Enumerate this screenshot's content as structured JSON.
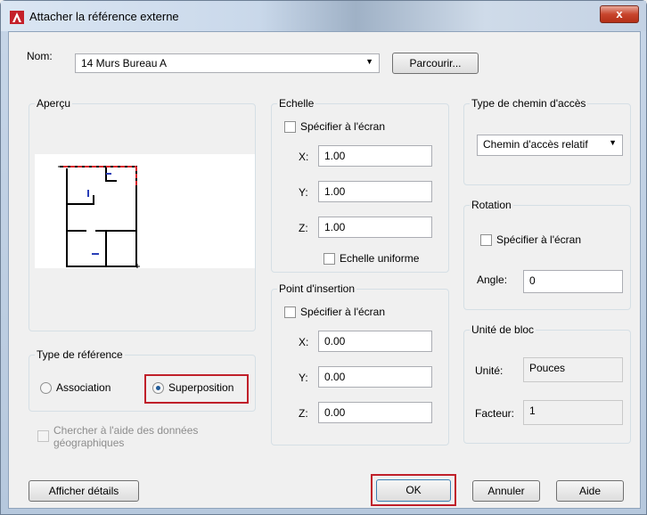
{
  "window": {
    "title": "Attacher la référence externe",
    "close_label": "x"
  },
  "name_row": {
    "label": "Nom:",
    "value": "14 Murs Bureau A",
    "browse_label": "Parcourir..."
  },
  "preview": {
    "title": "Aperçu"
  },
  "reference_type": {
    "title": "Type de référence",
    "options": [
      "Association",
      "Superposition"
    ],
    "selected": "Superposition"
  },
  "geo": {
    "line1": "Chercher à l'aide des données",
    "line2": "géographiques"
  },
  "scale": {
    "title": "Echelle",
    "specify_label": "Spécifier à l'écran",
    "x_label": "X:",
    "x_value": "1.00",
    "y_label": "Y:",
    "y_value": "1.00",
    "z_label": "Z:",
    "z_value": "1.00",
    "uniform_label": "Echelle uniforme"
  },
  "insertion": {
    "title": "Point d'insertion",
    "specify_label": "Spécifier à l'écran",
    "x_label": "X:",
    "x_value": "0.00",
    "y_label": "Y:",
    "y_value": "0.00",
    "z_label": "Z:",
    "z_value": "0.00"
  },
  "path_type": {
    "title": "Type de chemin d'accès",
    "value": "Chemin d'accès relatif"
  },
  "rotation": {
    "title": "Rotation",
    "specify_label": "Spécifier à l'écran",
    "angle_label": "Angle:",
    "angle_value": "0"
  },
  "block_unit": {
    "title": "Unité de bloc",
    "unit_label": "Unité:",
    "unit_value": "Pouces",
    "factor_label": "Facteur:",
    "factor_value": "1"
  },
  "buttons": {
    "details": "Afficher détails",
    "ok": "OK",
    "cancel": "Annuler",
    "help": "Aide"
  },
  "colors": {
    "highlight": "#c0202a",
    "title_bar": "#c9d8ea",
    "dialog_bg": "#f0f0f0"
  }
}
